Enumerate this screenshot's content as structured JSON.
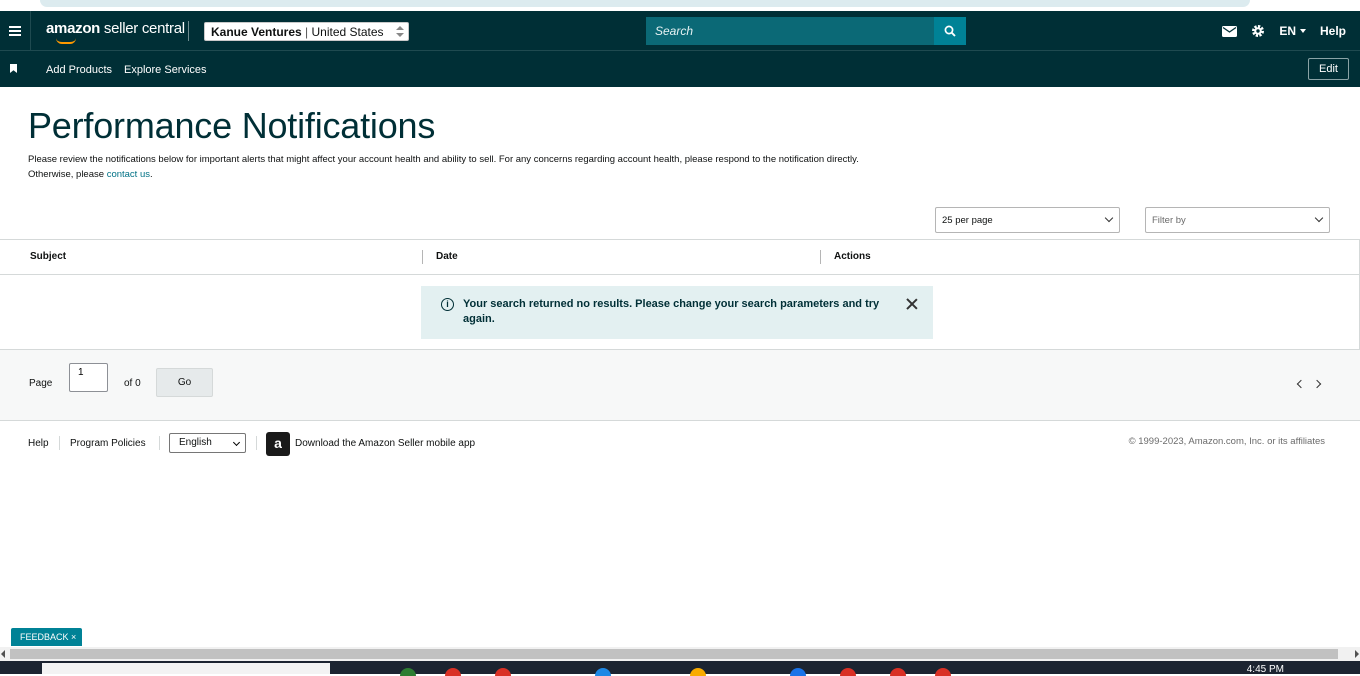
{
  "header": {
    "logo_main": "amazon",
    "logo_sub": " seller central",
    "account_name": "Kanue Ventures",
    "account_sep": " | ",
    "account_region": "United States",
    "search_placeholder": "Search",
    "language": "EN",
    "help": "Help"
  },
  "nav": {
    "add_products": "Add Products",
    "explore_services": "Explore Services",
    "edit": "Edit"
  },
  "page": {
    "title": "Performance Notifications",
    "description_pre": "Please review the notifications below for important alerts that might affect your account health and ability to sell. For any concerns regarding account health, please respond to the notification directly. Otherwise, please ",
    "description_link": "contact us",
    "description_post": "."
  },
  "controls": {
    "per_page": "25 per page",
    "filter_placeholder": "Filter by"
  },
  "table": {
    "columns": [
      "Subject",
      "Date",
      "Actions"
    ],
    "empty_message": "Your search returned no results. Please change your search parameters and try again."
  },
  "pagination": {
    "page_label": "Page",
    "page_value": "1",
    "of_label": "of 0",
    "go": "Go"
  },
  "footer": {
    "help": "Help",
    "program_policies": "Program Policies",
    "language": "English",
    "app_link": "Download the Amazon Seller mobile app",
    "copyright": "© 1999-2023, Amazon.com, Inc. or its affiliates"
  },
  "feedback": "FEEDBACK ×",
  "taskbar": {
    "time": "4:45 PM"
  },
  "colors": {
    "header_bg": "#002f36",
    "accent": "#008296",
    "search_bg": "#0b6976",
    "alert_bg": "#e3f0f1",
    "link": "#007185"
  }
}
